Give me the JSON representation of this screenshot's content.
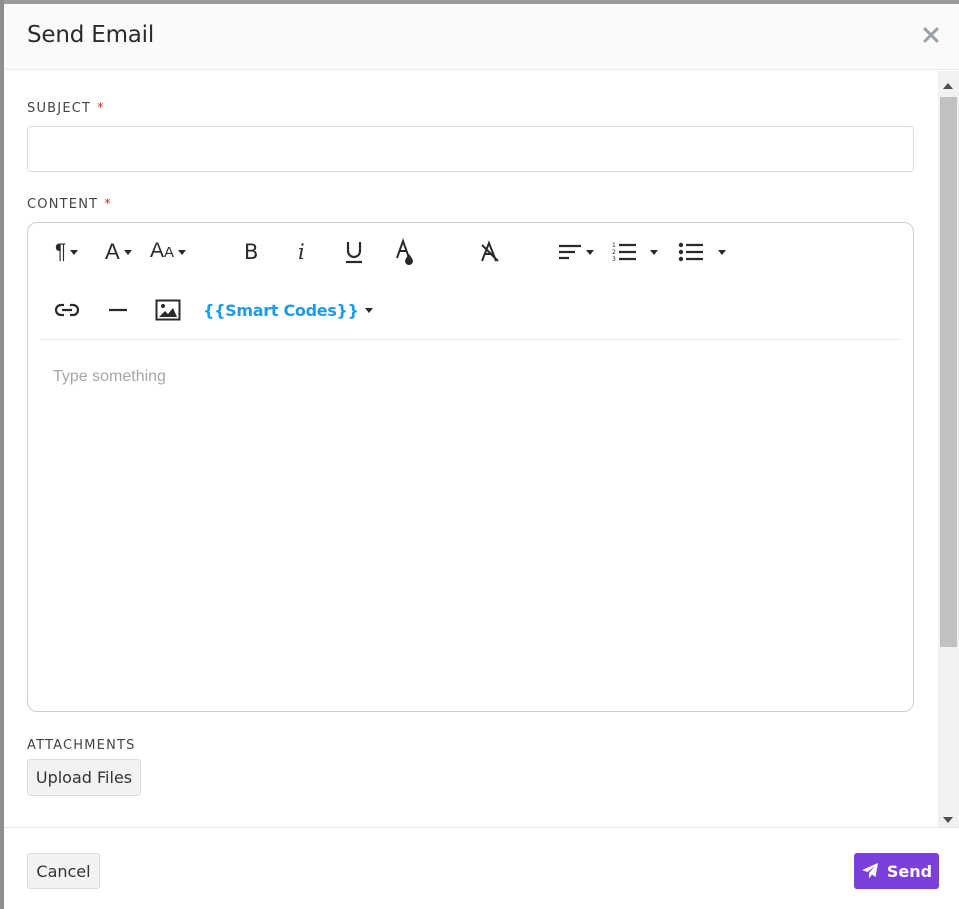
{
  "modal": {
    "title": "Send Email",
    "close_icon": "close-icon"
  },
  "form": {
    "subject": {
      "label": "SUBJECT",
      "required_mark": "*",
      "value": "",
      "placeholder": ""
    },
    "content": {
      "label": "CONTENT",
      "required_mark": "*",
      "placeholder": "Type something",
      "toolbar": {
        "row1": [
          {
            "name": "paragraph-format",
            "icon": "pilcrow-icon",
            "has_dropdown": true
          },
          {
            "name": "font-family",
            "icon": "font-icon",
            "has_dropdown": true
          },
          {
            "name": "font-size",
            "icon": "font-size-icon",
            "has_dropdown": true
          },
          {
            "name": "bold",
            "icon": "bold-icon",
            "has_dropdown": false
          },
          {
            "name": "italic",
            "icon": "italic-icon",
            "has_dropdown": false
          },
          {
            "name": "underline",
            "icon": "underline-icon",
            "has_dropdown": false
          },
          {
            "name": "text-color",
            "icon": "text-color-icon",
            "has_dropdown": false
          },
          {
            "name": "clear-formatting",
            "icon": "clear-formatting-icon",
            "has_dropdown": false
          },
          {
            "name": "align",
            "icon": "align-left-icon",
            "has_dropdown": true
          },
          {
            "name": "ordered-list",
            "icon": "ordered-list-icon",
            "has_dropdown": true
          },
          {
            "name": "unordered-list",
            "icon": "unordered-list-icon",
            "has_dropdown": true
          }
        ],
        "row2": [
          {
            "name": "insert-link",
            "icon": "link-icon"
          },
          {
            "name": "insert-horizontal-line",
            "icon": "horizontal-line-icon"
          },
          {
            "name": "insert-image",
            "icon": "image-icon"
          }
        ],
        "smart_codes_label": "{{Smart Codes}}"
      }
    },
    "attachments": {
      "label": "ATTACHMENTS",
      "upload_label": "Upload Files"
    }
  },
  "footer": {
    "cancel_label": "Cancel",
    "send_label": "Send",
    "send_icon": "paper-plane-icon"
  },
  "colors": {
    "accent": "#7c3fd9",
    "smart_codes": "#1e9be6",
    "required": "#d03030"
  }
}
